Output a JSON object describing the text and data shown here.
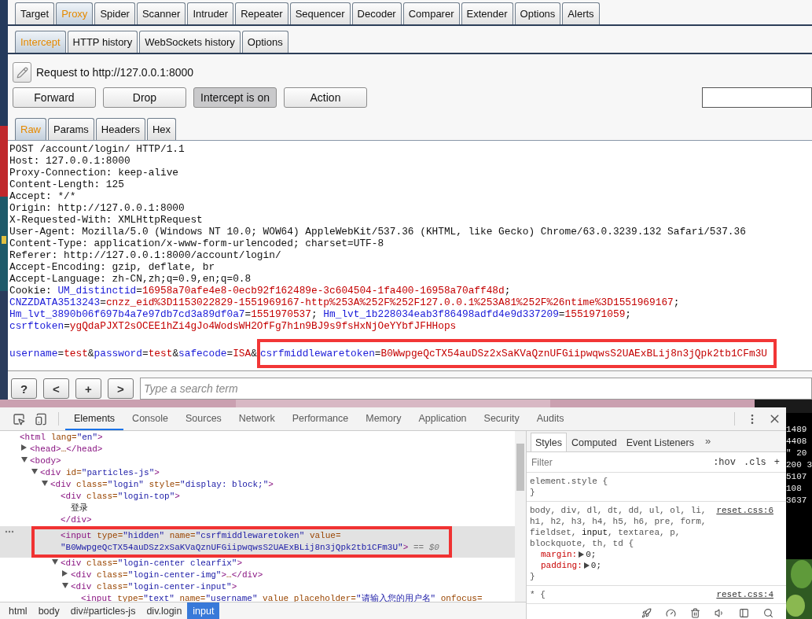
{
  "burp": {
    "tabs": [
      {
        "label": "Target",
        "selected": false
      },
      {
        "label": "Proxy",
        "selected": true
      },
      {
        "label": "Spider",
        "selected": false
      },
      {
        "label": "Scanner",
        "selected": false
      },
      {
        "label": "Intruder",
        "selected": false
      },
      {
        "label": "Repeater",
        "selected": false
      },
      {
        "label": "Sequencer",
        "selected": false
      },
      {
        "label": "Decoder",
        "selected": false
      },
      {
        "label": "Comparer",
        "selected": false
      },
      {
        "label": "Extender",
        "selected": false
      },
      {
        "label": "Options",
        "selected": false
      },
      {
        "label": "Alerts",
        "selected": false
      }
    ],
    "subtabs": [
      {
        "label": "Intercept",
        "selected": true
      },
      {
        "label": "HTTP history",
        "selected": false
      },
      {
        "label": "WebSockets history",
        "selected": false
      },
      {
        "label": "Options",
        "selected": false
      }
    ],
    "request_label": "Request to http://127.0.0.1:8000",
    "buttons": [
      {
        "label": "Forward",
        "pressed": false
      },
      {
        "label": "Drop",
        "pressed": false
      },
      {
        "label": "Intercept is on",
        "pressed": true
      },
      {
        "label": "Action",
        "pressed": false
      }
    ],
    "message_tabs": [
      {
        "label": "Raw",
        "selected": true
      },
      {
        "label": "Params",
        "selected": false
      },
      {
        "label": "Headers",
        "selected": false
      },
      {
        "label": "Hex",
        "selected": false
      }
    ],
    "request_lines": [
      {
        "segments": [
          {
            "text": "POST /account/login/ HTTP/1.1",
            "kind": "plain"
          }
        ]
      },
      {
        "segments": [
          {
            "text": "Host: 127.0.0.1:8000",
            "kind": "plain"
          }
        ]
      },
      {
        "segments": [
          {
            "text": "Proxy-Connection: keep-alive",
            "kind": "plain"
          }
        ]
      },
      {
        "segments": [
          {
            "text": "Content-Length: 125",
            "kind": "plain"
          }
        ]
      },
      {
        "segments": [
          {
            "text": "Accept: */*",
            "kind": "plain"
          }
        ]
      },
      {
        "segments": [
          {
            "text": "Origin: http://127.0.0.1:8000",
            "kind": "plain"
          }
        ]
      },
      {
        "segments": [
          {
            "text": "X-Requested-With: XMLHttpRequest",
            "kind": "plain"
          }
        ]
      },
      {
        "segments": [
          {
            "text": "User-Agent: Mozilla/5.0 (Windows NT 10.0; WOW64) AppleWebKit/537.36 (KHTML, like Gecko) Chrome/63.0.3239.132 Safari/537.36",
            "kind": "plain"
          }
        ]
      },
      {
        "segments": [
          {
            "text": "Content-Type: application/x-www-form-urlencoded; charset=UTF-8",
            "kind": "plain"
          }
        ]
      },
      {
        "segments": [
          {
            "text": "Referer: http://127.0.0.1:8000/account/login/",
            "kind": "plain"
          }
        ]
      },
      {
        "segments": [
          {
            "text": "Accept-Encoding: gzip, deflate, br",
            "kind": "plain"
          }
        ]
      },
      {
        "segments": [
          {
            "text": "Accept-Language: zh-CN,zh;q=0.9,en;q=0.8",
            "kind": "plain"
          }
        ]
      },
      {
        "segments": [
          {
            "text": "Cookie: ",
            "kind": "plain"
          },
          {
            "text": "UM_distinctid",
            "kind": "name"
          },
          {
            "text": "=",
            "kind": "plain"
          },
          {
            "text": "16958a70afe4e8-0ecb92f162489e-3c604504-1fa400-16958a70aff48d",
            "kind": "value"
          },
          {
            "text": ";",
            "kind": "plain"
          }
        ]
      },
      {
        "segments": [
          {
            "text": "CNZZDATA3513243",
            "kind": "name"
          },
          {
            "text": "=",
            "kind": "plain"
          },
          {
            "text": "cnzz_eid%3D1153022829-1551969167-http%253A%252F%252F127.0.0.1%253A81%252F%26ntime%3D1551969167",
            "kind": "value"
          },
          {
            "text": ";",
            "kind": "plain"
          }
        ]
      },
      {
        "segments": [
          {
            "text": "Hm_lvt_3890b06f697b4a7e97db7cd3a89df0a7",
            "kind": "name"
          },
          {
            "text": "=",
            "kind": "plain"
          },
          {
            "text": "1551970537",
            "kind": "value"
          },
          {
            "text": "; ",
            "kind": "plain"
          },
          {
            "text": "Hm_lvt_1b228034eab3f86498adfd4e9d337209",
            "kind": "name"
          },
          {
            "text": "=",
            "kind": "plain"
          },
          {
            "text": "1551971059",
            "kind": "value"
          },
          {
            "text": ";",
            "kind": "plain"
          }
        ]
      },
      {
        "segments": [
          {
            "text": "csrftoken",
            "kind": "name"
          },
          {
            "text": "=",
            "kind": "plain"
          },
          {
            "text": "ygQdaPJXT2sOCEE1hZi4gJo4WodsWH2OfFg7h1n9BJ9s9fsHxNjOeYYbfJFHHops",
            "kind": "value"
          }
        ]
      },
      {
        "segments": [
          {
            "text": "username",
            "kind": "name"
          },
          {
            "text": "=",
            "kind": "plain"
          },
          {
            "text": "test",
            "kind": "value"
          },
          {
            "text": "&",
            "kind": "plain"
          },
          {
            "text": "password",
            "kind": "name"
          },
          {
            "text": "=",
            "kind": "plain"
          },
          {
            "text": "test",
            "kind": "value"
          },
          {
            "text": "&",
            "kind": "plain"
          },
          {
            "text": "safecode",
            "kind": "name"
          },
          {
            "text": "=",
            "kind": "plain"
          },
          {
            "text": "ISA",
            "kind": "value"
          },
          {
            "text": "&",
            "kind": "plain"
          }
        ],
        "highlight": [
          {
            "text": "csrfmiddlewaretoken",
            "kind": "name"
          },
          {
            "text": "=",
            "kind": "plain"
          },
          {
            "text": "B0WwpgeQcTX54auDSz2xSaKVaQznUFGiipwqwsS2UAExBLij8n3jQpk2tb1CFm3U",
            "kind": "value"
          }
        ]
      }
    ],
    "search": {
      "buttons": [
        "?",
        "<",
        "+",
        ">"
      ],
      "placeholder": "Type a search term"
    }
  },
  "devtools": {
    "tabs": [
      {
        "label": "Elements",
        "selected": true
      },
      {
        "label": "Console",
        "selected": false
      },
      {
        "label": "Sources",
        "selected": false
      },
      {
        "label": "Network",
        "selected": false
      },
      {
        "label": "Performance",
        "selected": false
      },
      {
        "label": "Memory",
        "selected": false
      },
      {
        "label": "Application",
        "selected": false
      },
      {
        "label": "Security",
        "selected": false
      },
      {
        "label": "Audits",
        "selected": false
      }
    ],
    "dom": [
      {
        "text": "<html lang=\"en\">",
        "selected": false,
        "children": [
          {
            "text": "<head>…</head>",
            "expanded": false,
            "selected": false
          },
          {
            "text": "<body>",
            "expanded": true,
            "selected": false,
            "children": [
              {
                "text": "<div id=\"particles-js\">",
                "expanded": true,
                "selected": false,
                "children": [
                  {
                    "text": "<div class=\"login\" style=\"display: block;\">",
                    "expanded": true,
                    "selected": false,
                    "children": [
                      {
                        "text": "<div class=\"login-top\">",
                        "selected": false,
                        "children": [
                          {
                            "text": "登录",
                            "selected": false
                          }
                        ],
                        "closing": "</div>"
                      },
                      {
                        "text": "<input type=\"hidden\" name=\"csrfmiddlewaretoken\" value=",
                        "text_2": "\"B0WwpgeQcTX54auDSz2xSaKVaQznUFGiipwqwsS2UAExBLij8n3jQpk2tb1CFm3U\">",
                        "suffix": "== $0",
                        "selected": true,
                        "annotated": true
                      },
                      {
                        "text": "<div class=\"login-center clearfix\">",
                        "expanded": true,
                        "selected": false,
                        "children": [
                          {
                            "text": "<div class=\"login-center-img\">…</div>",
                            "expanded": false,
                            "selected": false
                          },
                          {
                            "text": "<div class=\"login-center-input\">",
                            "expanded": true,
                            "selected": false,
                            "children": [
                              {
                                "text": "<input type=\"text\" name=\"username\" value placeholder=\"请输入您的用户名\" onfocus=",
                                "selected": false
                              }
                            ]
                          }
                        ]
                      }
                    ]
                  }
                ]
              }
            ]
          }
        ]
      }
    ],
    "breadcrumbs": [
      {
        "label": "html",
        "selected": false
      },
      {
        "label": "body",
        "selected": false
      },
      {
        "label": "div#particles-js",
        "selected": false
      },
      {
        "label": "div.login",
        "selected": false
      },
      {
        "label": "input",
        "selected": true
      }
    ],
    "styles_tabs": [
      {
        "label": "Styles",
        "selected": true
      },
      {
        "label": "Computed",
        "selected": false
      },
      {
        "label": "Event Listeners",
        "selected": false
      }
    ],
    "styles_more": "»",
    "filter": {
      "placeholder": "Filter",
      "toggles": [
        ":hov",
        ".cls",
        "+"
      ]
    },
    "rules": [
      {
        "selector": "element.style {",
        "close": "}"
      },
      {
        "selector": "body, div, dl, dt, dd, ul, ol, li, h1, h2, h3, h4, h5, h6, pre, form, fieldset, **input**, textarea, p, blockquote, th, td {",
        "source": "reset.css:6",
        "properties": [
          {
            "name": "margin:",
            "value": "0;"
          },
          {
            "name": "padding:",
            "value": "0;"
          }
        ],
        "close": "}"
      },
      {
        "selector": "* {",
        "source": "reset.css:4"
      }
    ]
  },
  "terminal": {
    "lines": [
      "1489",
      "4408",
      "″ 20",
      "200 3",
      "5107",
      "108",
      "3637"
    ]
  }
}
